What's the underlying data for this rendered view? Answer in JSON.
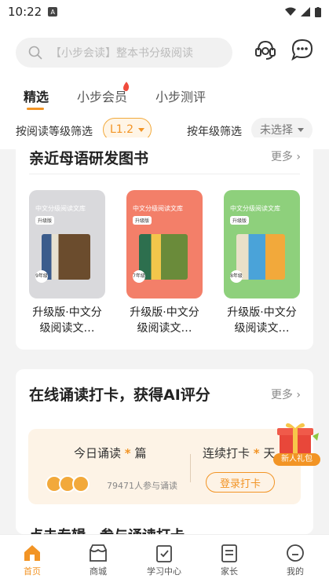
{
  "status": {
    "time": "10:22"
  },
  "search": {
    "placeholder": "【小步会读】整本书分级阅读"
  },
  "tabs": [
    {
      "label": "精选",
      "active": true
    },
    {
      "label": "小步会员",
      "active": false
    },
    {
      "label": "小步测评",
      "active": false
    }
  ],
  "filters": {
    "level_label": "按阅读等级筛选",
    "level_value": "L1.2",
    "grade_label": "按年级筛选",
    "grade_value": "未选择"
  },
  "section1": {
    "title": "亲近母语研发图书",
    "more": "更多",
    "books": [
      {
        "title": "升级版·中文分级阅读文…",
        "cover_series": "中文分级阅读文库",
        "cover_tag": "升级版",
        "badge": "9年级",
        "color": "#d9d9dc"
      },
      {
        "title": "升级版·中文分级阅读文…",
        "cover_series": "中文分级阅读文库",
        "cover_tag": "升级版",
        "badge": "7年级",
        "color": "#f37f69"
      },
      {
        "title": "升级版·中文分级阅读文…",
        "cover_series": "中文分级阅读文库",
        "cover_tag": "升级版",
        "badge": "8年级",
        "color": "#8ed07c"
      }
    ]
  },
  "section2": {
    "title": "在线诵读打卡，获得AI评分",
    "more": "更多",
    "today_label": "今日诵读",
    "today_value": "*",
    "today_unit": "篇",
    "streak_label": "连续打卡",
    "streak_value": "*",
    "streak_unit": "天",
    "participants": "79471人参与诵读",
    "login_button": "登录打卡"
  },
  "gift": {
    "label": "新人礼包"
  },
  "section3": {
    "title": "点击专辑，参与诵读打卡"
  },
  "bottom_nav": [
    {
      "label": "首页",
      "icon": "home-icon",
      "active": true
    },
    {
      "label": "商城",
      "icon": "store-icon",
      "active": false
    },
    {
      "label": "学习中心",
      "icon": "study-icon",
      "active": false
    },
    {
      "label": "家长",
      "icon": "parent-icon",
      "active": false
    },
    {
      "label": "我的",
      "icon": "profile-icon",
      "active": false
    }
  ],
  "colors": {
    "accent": "#f29425"
  }
}
